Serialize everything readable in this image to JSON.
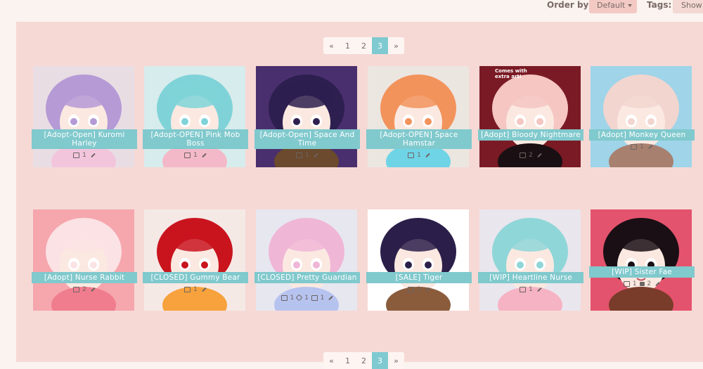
{
  "filters": {
    "order_label": "Order by:",
    "order_value": "Default",
    "tags_label": "Tags:",
    "tags_value": "Show"
  },
  "pagination": {
    "prev": "«",
    "pages": [
      "1",
      "2",
      "3"
    ],
    "current": "3",
    "next": "»"
  },
  "items": [
    {
      "title": "[Adopt-Open] Kuromi Harley",
      "images": "1",
      "palette": [
        "#e9dde4",
        "#b59ad6",
        "#f2c5dd"
      ]
    },
    {
      "title": "[Adopt-OPEN] Pink Mob Boss",
      "images": "1",
      "palette": [
        "#d7ecec",
        "#7fd3d8",
        "#f4b9c9"
      ]
    },
    {
      "title": "[Adopt-Open] Space And Time",
      "images": "1",
      "palette": [
        "#4a2f6e",
        "#2d1f4f",
        "#6b4a2e"
      ]
    },
    {
      "title": "[Adopt-OPEN] Space Hamstar",
      "images": "1",
      "palette": [
        "#ece6e0",
        "#f2935c",
        "#6fd4e6"
      ]
    },
    {
      "title": "[Adopt] Bloody Nightmare",
      "images": "2",
      "palette": [
        "#7a1a24",
        "#f5c6c2",
        "#1a1014"
      ],
      "badge": "Comes with extra art!"
    },
    {
      "title": "[Adopt] Monkey Queen",
      "images": "1",
      "palette": [
        "#9fd4e9",
        "#f2d5cf",
        "#a88070"
      ]
    },
    {
      "title": "[Adopt] Nurse Rabbit",
      "images": "2",
      "palette": [
        "#f6a6ad",
        "#fbe2e4",
        "#f07d8d"
      ]
    },
    {
      "title": "[CLOSED] Gummy Bear",
      "images": "1",
      "palette": [
        "#f5e9e6",
        "#c9141e",
        "#f7a23c"
      ]
    },
    {
      "title": "[CLOSED] Pretty Guardian",
      "images": "1",
      "links": "1",
      "edits": "1",
      "palette": [
        "#e7e7f0",
        "#f0b6d6",
        "#b7c3ef"
      ]
    },
    {
      "title": "[SALE] Tiger",
      "images": "1",
      "palette": [
        "#ffffff",
        "#2b1f4a",
        "#8a5c3c"
      ]
    },
    {
      "title": "[WIP] Heartline Nurse",
      "images": "1",
      "palette": [
        "#e9e6ee",
        "#8fd6d8",
        "#f5b3c4"
      ]
    },
    {
      "title": "[WIP] Sister Fae",
      "images": "1",
      "comments": "2",
      "palette": [
        "#e4536d",
        "#1a0f15",
        "#7a3c2a"
      ]
    }
  ]
}
